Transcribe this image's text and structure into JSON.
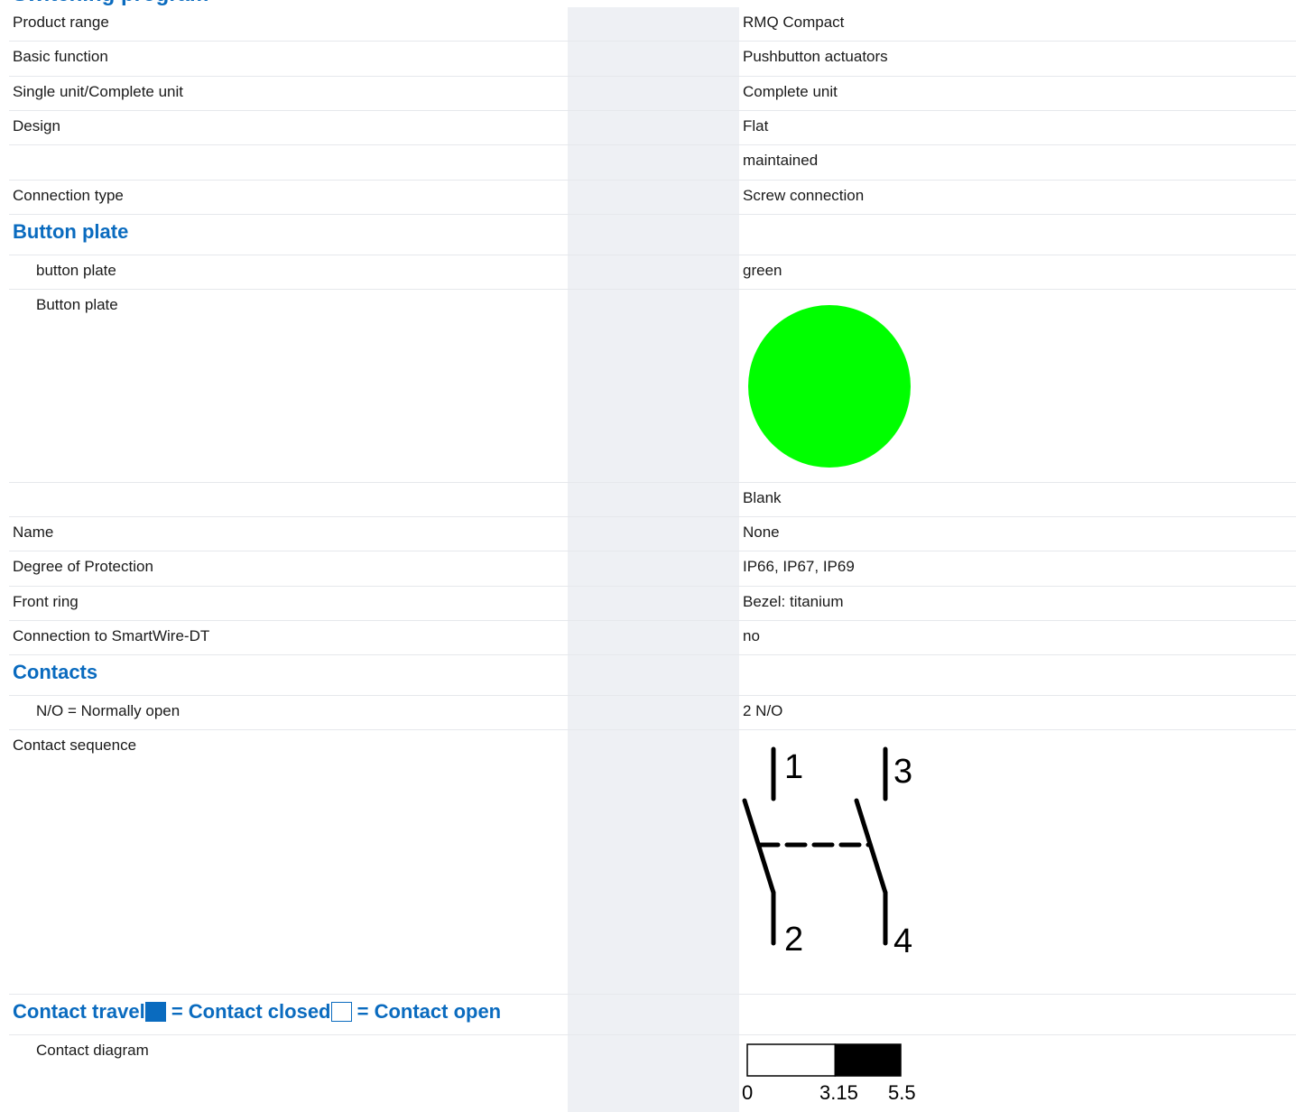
{
  "page_heading": "Switching program",
  "colors": {
    "accent": "#0a6bbf",
    "button_plate_swatch": "#00ff00"
  },
  "rows": [
    {
      "label": "Product range",
      "value": "RMQ Compact"
    },
    {
      "label": "Basic function",
      "value": "Pushbutton actuators"
    },
    {
      "label": "Single unit/Complete unit",
      "value": "Complete unit"
    },
    {
      "label": "Design",
      "value": "Flat"
    },
    {
      "label": "",
      "value": "maintained"
    },
    {
      "label": "Connection type",
      "value": "Screw connection"
    }
  ],
  "button_plate_section": {
    "heading": "Button plate",
    "color_label": "button plate",
    "color_value": "green",
    "image_label": "Button plate",
    "inscription_value": "Blank"
  },
  "rows2": [
    {
      "label": "Name",
      "value": "None"
    },
    {
      "label": "Degree of Protection",
      "value": "IP66, IP67, IP69"
    },
    {
      "label": "Front ring",
      "value": "Bezel: titanium"
    },
    {
      "label": "Connection to SmartWire-DT",
      "value": "no"
    }
  ],
  "contacts_section": {
    "heading": "Contacts",
    "no_label": "N/O = Normally open",
    "no_value": "2 N/O",
    "sequence_label": "Contact sequence",
    "terminals": [
      "1",
      "2",
      "3",
      "4"
    ]
  },
  "contact_travel": {
    "heading_start": "Contact travel",
    "closed_text": " = Contact closed",
    "open_text": " = Contact open",
    "diagram_label": "Contact diagram",
    "diagram": {
      "travel_max": 5.5,
      "closed_from": 3.15,
      "closed_to": 5.5,
      "ticks": [
        "0",
        "3.15",
        "5.5"
      ]
    }
  }
}
